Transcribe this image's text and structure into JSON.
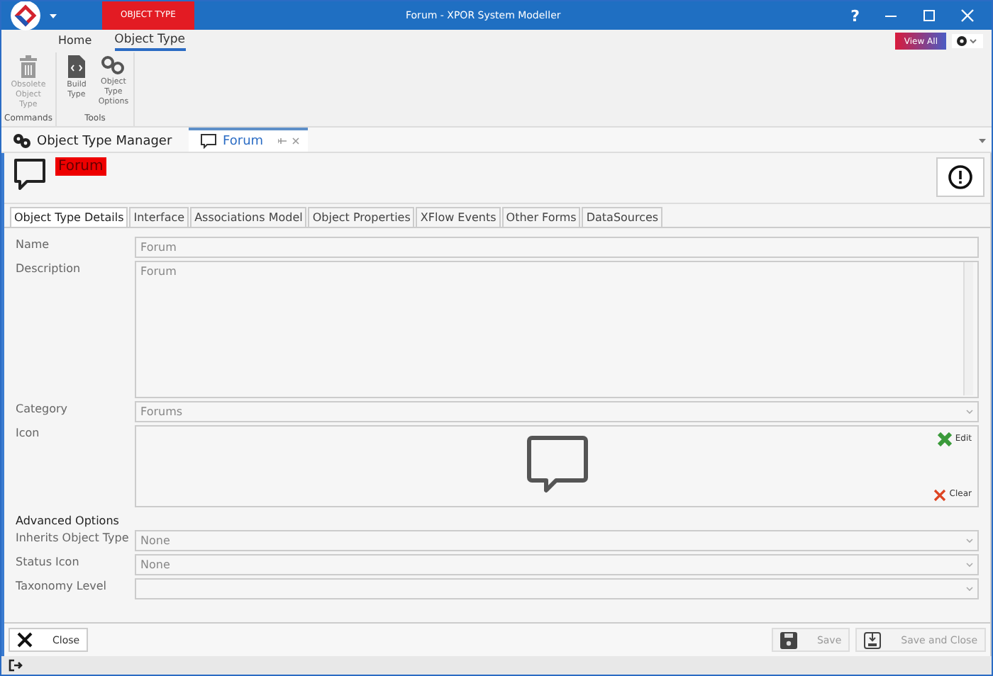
{
  "window": {
    "title": "Forum - XPOR System Modeller",
    "context_tab": "OBJECT TYPE",
    "help": "?"
  },
  "ribbon": {
    "tabs": [
      {
        "label": "Home",
        "selected": false
      },
      {
        "label": "Object Type",
        "selected": true
      }
    ],
    "view_all": "View All",
    "groups": [
      {
        "label": "Commands",
        "items": [
          {
            "label": "Obsolete Object Type",
            "disabled": true
          }
        ]
      },
      {
        "label": "Tools",
        "items": [
          {
            "label": "Build Type",
            "disabled": false
          },
          {
            "label": "Object Type Options",
            "disabled": false
          }
        ]
      }
    ]
  },
  "doc_tabs": [
    {
      "label": "Object Type Manager",
      "selected": false
    },
    {
      "label": "Forum",
      "selected": true
    }
  ],
  "header": {
    "title": "Forum"
  },
  "form_tabs": [
    {
      "label": "Object Type Details",
      "selected": true
    },
    {
      "label": "Interface",
      "selected": false
    },
    {
      "label": "Associations Model",
      "selected": false
    },
    {
      "label": "Object Properties",
      "selected": false
    },
    {
      "label": "XFlow Events",
      "selected": false
    },
    {
      "label": "Other Forms",
      "selected": false
    },
    {
      "label": "DataSources",
      "selected": false
    }
  ],
  "fields": [
    {
      "kind": "text",
      "label": "Name",
      "value": "Forum"
    },
    {
      "kind": "textarea",
      "label": "Description",
      "value": "Forum"
    },
    {
      "kind": "dropdown",
      "label": "Category",
      "value": "Forums"
    },
    {
      "kind": "icon",
      "label": "Icon",
      "edit": "Edit",
      "clear": "Clear"
    },
    {
      "kind": "section",
      "label": "Advanced Options"
    },
    {
      "kind": "dropdown",
      "label": "Inherits Object Type",
      "value": "None"
    },
    {
      "kind": "dropdown",
      "label": "Status Icon",
      "value": "None"
    },
    {
      "kind": "dropdown",
      "label": "Taxonomy Level"
    }
  ],
  "buttons": [
    {
      "label": "Close",
      "disabled": false
    },
    {
      "label": "Save",
      "disabled": true
    },
    {
      "label": "Save and Close",
      "disabled": true
    }
  ]
}
